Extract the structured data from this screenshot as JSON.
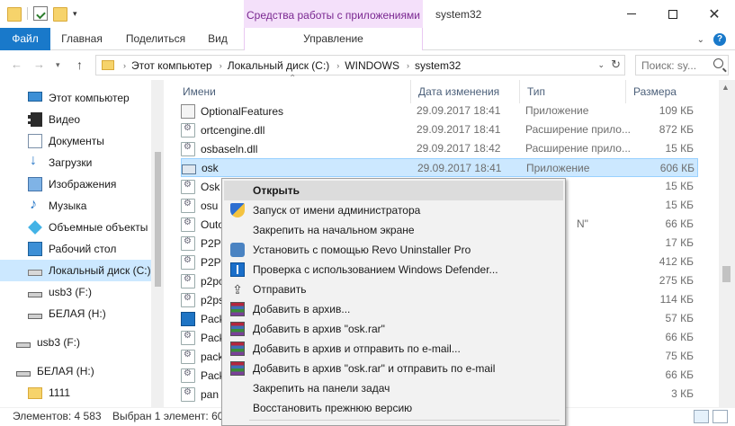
{
  "window": {
    "title": "system32",
    "context_tab_header": "Средства работы с приложениями"
  },
  "ribbon": {
    "tabs": {
      "file": "Файл",
      "home": "Главная",
      "share": "Поделиться",
      "view": "Вид",
      "manage": "Управление"
    }
  },
  "address": {
    "crumbs": [
      "Этот компьютер",
      "Локальный диск (C:)",
      "WINDOWS",
      "system32"
    ],
    "search_placeholder": "Поиск: sy..."
  },
  "navpane": {
    "items": [
      {
        "label": "Этот компьютер",
        "icon": "computer-icon"
      },
      {
        "label": "Видео",
        "icon": "video-icon"
      },
      {
        "label": "Документы",
        "icon": "documents-icon"
      },
      {
        "label": "Загрузки",
        "icon": "downloads-icon"
      },
      {
        "label": "Изображения",
        "icon": "images-icon"
      },
      {
        "label": "Музыка",
        "icon": "music-icon"
      },
      {
        "label": "Объемные объекты",
        "icon": "3d-objects-icon"
      },
      {
        "label": "Рабочий стол",
        "icon": "desktop-icon"
      },
      {
        "label": "Локальный диск (C:)",
        "icon": "drive-icon"
      },
      {
        "label": "usb3 (F:)",
        "icon": "usb-drive-icon"
      },
      {
        "label": "БЕЛАЯ (H:)",
        "icon": "usb-drive-icon"
      },
      {
        "label": "usb3 (F:)",
        "icon": "usb-drive-icon"
      },
      {
        "label": "БЕЛАЯ (H:)",
        "icon": "usb-drive-icon"
      },
      {
        "label": "1111",
        "icon": "folder-icon"
      }
    ]
  },
  "columns": {
    "name": "Имени",
    "date": "Дата изменения",
    "type": "Тип",
    "size": "Размера"
  },
  "files": [
    {
      "name": "OptionalFeatures",
      "date": "29.09.2017 18:41",
      "type": "Приложение",
      "size": "109 КБ",
      "icon": "app"
    },
    {
      "name": "ortcengine.dll",
      "date": "29.09.2017 18:41",
      "type": "Расширение прило...",
      "size": "872 КБ",
      "icon": "dll"
    },
    {
      "name": "osbaseln.dll",
      "date": "29.09.2017 18:42",
      "type": "Расширение прило...",
      "size": "15 КБ",
      "icon": "dll"
    },
    {
      "name": "osk",
      "date": "29.09.2017 18:41",
      "type": "Приложение",
      "size": "606 КБ",
      "icon": "osk"
    },
    {
      "name": "Osk",
      "date": "",
      "type": "",
      "size": "15 КБ",
      "icon": "dll"
    },
    {
      "name": "osu",
      "date": "",
      "type": "",
      "size": "15 КБ",
      "icon": "dll"
    },
    {
      "name": "Outo",
      "date": "",
      "type": "N\"",
      "size": "66 КБ",
      "icon": "dll"
    },
    {
      "name": "P2P",
      "date": "",
      "type": "",
      "size": "17 КБ",
      "icon": "dll"
    },
    {
      "name": "P2P",
      "date": "",
      "type": "",
      "size": "412 КБ",
      "icon": "dll"
    },
    {
      "name": "p2pc",
      "date": "",
      "type": "",
      "size": "275 КБ",
      "icon": "dll"
    },
    {
      "name": "p2ps",
      "date": "",
      "type": "",
      "size": "114 КБ",
      "icon": "dll"
    },
    {
      "name": "Pack",
      "date": "",
      "type": "",
      "size": "57 КБ",
      "icon": "pack"
    },
    {
      "name": "Pack",
      "date": "",
      "type": "",
      "size": "66 КБ",
      "icon": "dll"
    },
    {
      "name": "pack",
      "date": "",
      "type": "",
      "size": "75 КБ",
      "icon": "dll"
    },
    {
      "name": "Pack",
      "date": "",
      "type": "",
      "size": "66 КБ",
      "icon": "dll"
    },
    {
      "name": "pan",
      "date": "",
      "type": "",
      "size": "3 КБ",
      "icon": "dll"
    }
  ],
  "status": {
    "count": "Элементов: 4 583",
    "selected": "Выбран 1 элемент: 605 КБ"
  },
  "context_menu": {
    "items": [
      {
        "label": "Открыть",
        "icon": "",
        "bold": true,
        "hover": true
      },
      {
        "label": "Запуск от имени администратора",
        "icon": "shield"
      },
      {
        "label": "Закрепить на начальном экране",
        "icon": ""
      },
      {
        "label": "Установить с помощью Revo Uninstaller Pro",
        "icon": "revo"
      },
      {
        "label": "Проверка с использованием Windows Defender...",
        "icon": "defender"
      },
      {
        "label": "Отправить",
        "icon": "send"
      },
      {
        "label": "Добавить в архив...",
        "icon": "rar"
      },
      {
        "label": "Добавить в архив \"osk.rar\"",
        "icon": "rar"
      },
      {
        "label": "Добавить в архив и отправить по e-mail...",
        "icon": "rar"
      },
      {
        "label": "Добавить в архив \"osk.rar\" и отправить по e-mail",
        "icon": "rar"
      },
      {
        "label": "Закрепить на панели задач",
        "icon": ""
      },
      {
        "label": "Восстановить прежнюю версию",
        "icon": ""
      }
    ]
  }
}
